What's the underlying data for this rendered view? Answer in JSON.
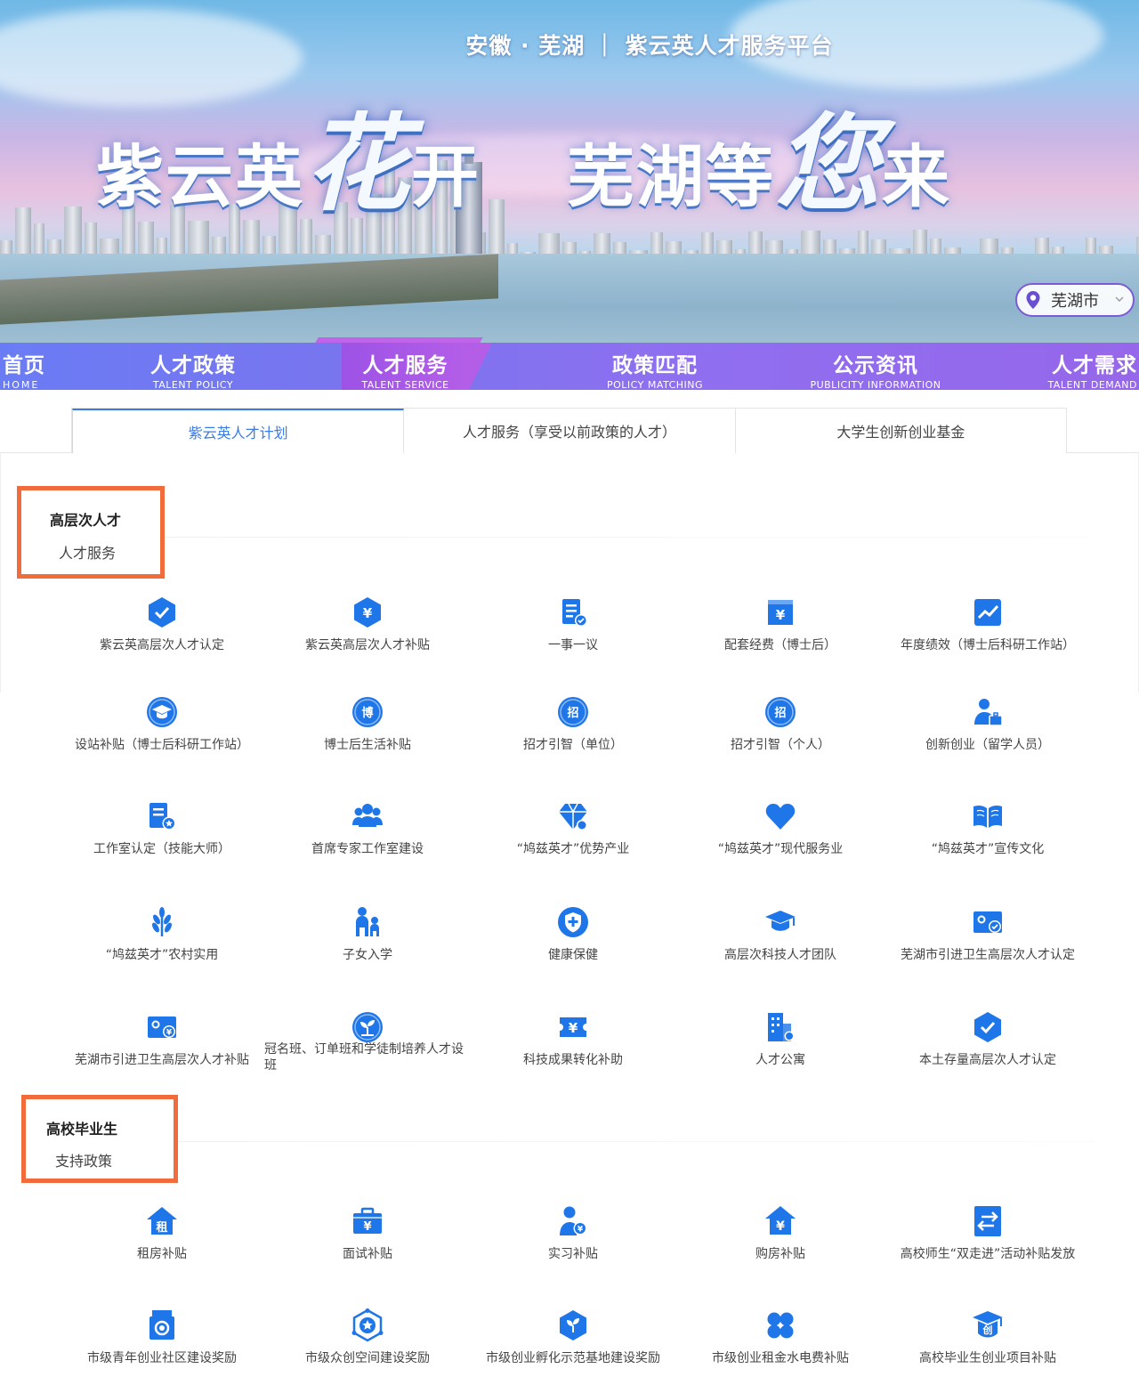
{
  "banner": {
    "subtitle": "安徽 · 芜湖 ｜ 紫云英人才服务平台",
    "headline_a": "紫云英",
    "headline_b": "花",
    "headline_c": "开",
    "headline_d": "芜湖等",
    "headline_e": "您",
    "headline_f": "来",
    "city": "芜湖市"
  },
  "nav": [
    {
      "cn": "首页",
      "en": "HOME"
    },
    {
      "cn": "人才政策",
      "en": "TALENT POLICY"
    },
    {
      "cn": "人才服务",
      "en": "TALENT SERVICE"
    },
    {
      "cn": "政策匹配",
      "en": "POLICY MATCHING"
    },
    {
      "cn": "公示资讯",
      "en": "PUBLICITY INFORMATION"
    },
    {
      "cn": "人才需求",
      "en": "TALENT DEMAND"
    }
  ],
  "tabs": [
    "紫云英人才计划",
    "人才服务（享受以前政策的人才）",
    "大学生创新创业基金"
  ],
  "section1": {
    "title": "高层次人才",
    "subtitle": "人才服务",
    "items": [
      {
        "label": "紫云英高层次人才认定",
        "icon": "shield-check-icon"
      },
      {
        "label": "紫云英高层次人才补贴",
        "icon": "hexagon-yuan-icon"
      },
      {
        "label": "一事一议",
        "icon": "document-check-icon"
      },
      {
        "label": "配套经费（博士后）",
        "icon": "box-yuan-icon"
      },
      {
        "label": "年度绩效（博士后科研工作站）",
        "icon": "trend-chart-icon"
      },
      {
        "label": "设站补贴（博士后科研工作站）",
        "icon": "graduation-circle-icon"
      },
      {
        "label": "博士后生活补贴",
        "icon": "bo-circle-icon"
      },
      {
        "label": "招才引智（单位）",
        "icon": "zhao-circle-icon"
      },
      {
        "label": "招才引智（个人）",
        "icon": "zhao-circle-icon"
      },
      {
        "label": "创新创业（留学人员）",
        "icon": "person-briefcase-icon"
      },
      {
        "label": "工作室认定（技能大师）",
        "icon": "document-star-icon"
      },
      {
        "label": "首席专家工作室建设",
        "icon": "team-icon"
      },
      {
        "label": "“鸠兹英才”优势产业",
        "icon": "diamond-icon"
      },
      {
        "label": "“鸠兹英才”现代服务业",
        "icon": "heart-icon"
      },
      {
        "label": "“鸠兹英才”宣传文化",
        "icon": "book-icon"
      },
      {
        "label": "“鸠兹英才”农村实用",
        "icon": "wheat-icon"
      },
      {
        "label": "子女入学",
        "icon": "parent-child-icon"
      },
      {
        "label": "健康保健",
        "icon": "health-shield-icon"
      },
      {
        "label": "高层次科技人才团队",
        "icon": "graduation-cap-icon"
      },
      {
        "label": "芜湖市引进卫生高层次人才认定",
        "icon": "card-check-icon"
      },
      {
        "label": "芜湖市引进卫生高层次人才补贴",
        "icon": "card-money-icon"
      },
      {
        "label": "冠名班、订单班和学徒制培养人才设班",
        "icon": "sprout-circle-icon"
      },
      {
        "label": "科技成果转化补助",
        "icon": "ticket-yuan-icon"
      },
      {
        "label": "人才公寓",
        "icon": "apartment-icon"
      },
      {
        "label": "本土存量高层次人才认定",
        "icon": "shield-check-icon"
      }
    ]
  },
  "section2": {
    "title": "高校毕业生",
    "subtitle": "支持政策",
    "items": [
      {
        "label": "租房补贴",
        "icon": "house-rent-icon"
      },
      {
        "label": "面试补贴",
        "icon": "briefcase-yuan-icon"
      },
      {
        "label": "实习补贴",
        "icon": "person-coin-icon"
      },
      {
        "label": "购房补贴",
        "icon": "house-yuan-icon"
      },
      {
        "label": "高校师生“双走进”活动补贴发放",
        "icon": "exchange-icon"
      },
      {
        "label": "市级青年创业社区建设奖励",
        "icon": "medal-icon"
      },
      {
        "label": "市级众创空间建设奖励",
        "icon": "hex-star-icon"
      },
      {
        "label": "市级创业孵化示范基地建设奖励",
        "icon": "shield-sprout-icon"
      },
      {
        "label": "市级创业租金水电费补贴",
        "icon": "clover-icon"
      },
      {
        "label": "高校毕业生创业项目补贴",
        "icon": "cap-chuang-icon"
      }
    ]
  },
  "colors": {
    "accent": "#3b7be6",
    "icon_blue": "#1f76e8",
    "highlight": "#f26b3a",
    "nav_start": "#6a7cf4",
    "nav_end": "#9667ea"
  }
}
